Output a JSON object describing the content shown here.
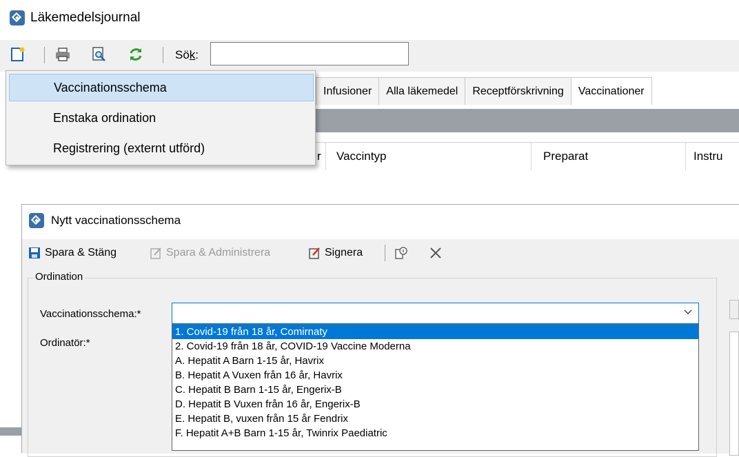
{
  "app": {
    "title": "Läkemedelsjournal"
  },
  "toolbar": {
    "search_label_prefix": "Sö",
    "search_label_accel": "k",
    "search_label_suffix": ":",
    "search_value": ""
  },
  "menu": {
    "items": [
      {
        "label": "Vaccinationsschema",
        "highlighted": true
      },
      {
        "label": "Enstaka ordination",
        "highlighted": false
      },
      {
        "label": "Registrering (externt utförd)",
        "highlighted": false
      }
    ]
  },
  "tabs": [
    {
      "label": "Infusioner",
      "active": false
    },
    {
      "label": "Alla läkemedel",
      "active": false
    },
    {
      "label": "Receptförskrivning",
      "active": false
    },
    {
      "label": "Vaccinationer",
      "active": true
    }
  ],
  "table": {
    "partial_header": "r",
    "columns": [
      "Vaccintyp",
      "Preparat",
      "Instru"
    ]
  },
  "dialog": {
    "title": "Nytt vaccinationsschema",
    "toolbar": {
      "save_close": "Spara & Stäng",
      "save_admin": "Spara & Administrera",
      "sign": "Signera"
    },
    "group_label": "Ordination",
    "schedule_label": "Vaccinationsschema:*",
    "prescriber_label": "Ordinatör:*",
    "schedule_value": "",
    "options": [
      "1. Covid-19 från 18 år, Comirnaty",
      "2. Covid-19 från 18 år, COVID-19 Vaccine Moderna",
      "A. Hepatit A Barn 1-15 år, Havrix",
      "B. Hepatit A Vuxen från 16 år, Havrix",
      "C. Hepatit B Barn 1-15 år, Engerix-B",
      "D. Hepatit B Vuxen från 16 år, Engerix-B",
      "E. Hepatit B, vuxen från 15 år Fendrix",
      "F. Hepatit A+B Barn 1-15 år, Twinrix Paediatric"
    ],
    "selected_index": 0
  },
  "colors": {
    "accent": "#0078d7",
    "highlight": "#cfe3f7",
    "darkbar": "#9aa0a6"
  }
}
